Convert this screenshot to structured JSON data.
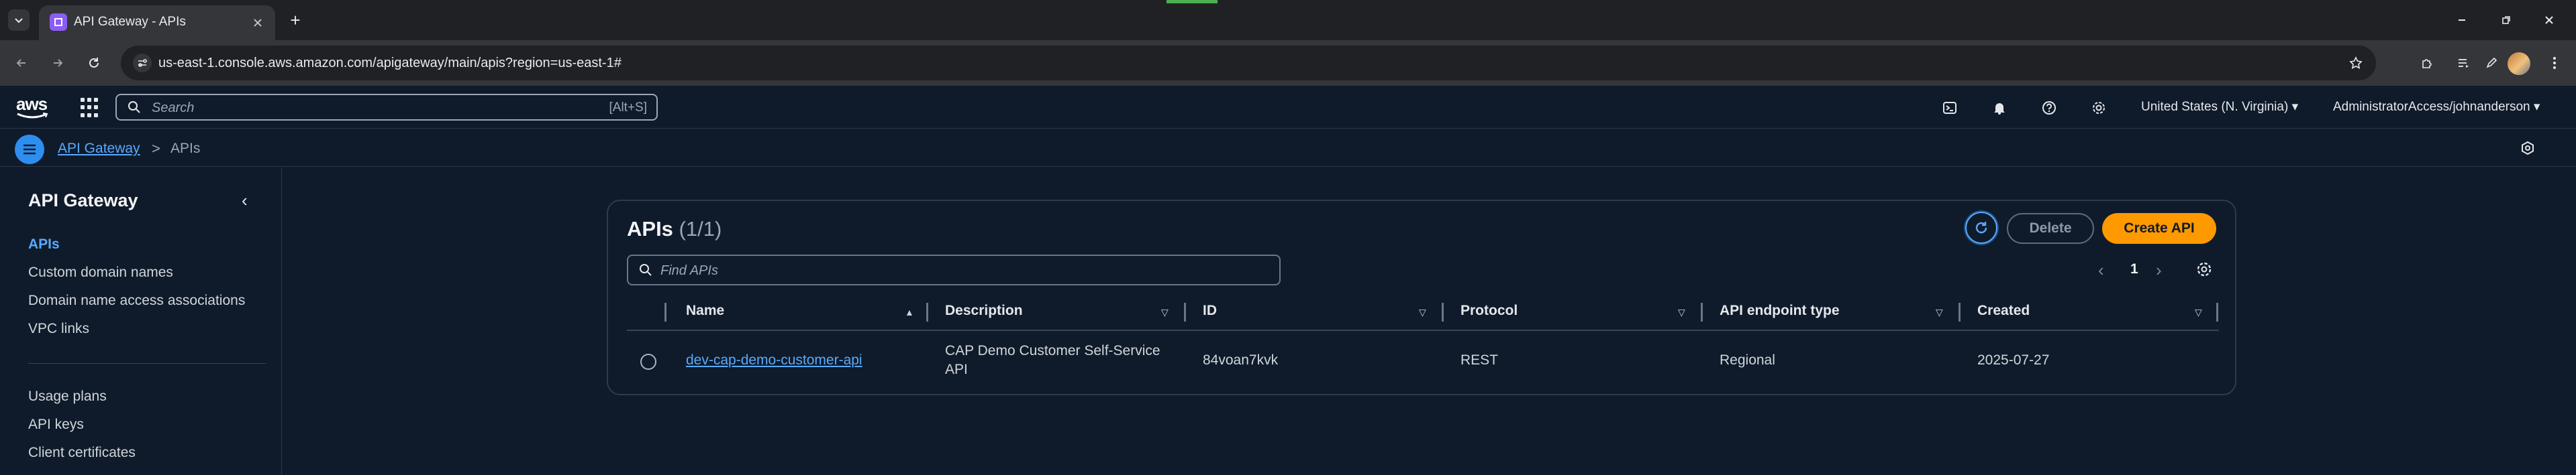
{
  "browser": {
    "tab_title": "API Gateway - APIs",
    "url": "us-east-1.console.aws.amazon.com/apigateway/main/apis?region=us-east-1#"
  },
  "console": {
    "logo_text": "aws",
    "search_placeholder": "Search",
    "search_shortcut": "[Alt+S]",
    "region": "United States (N. Virginia) ▾",
    "account": "AdministratorAccess/johnanderson ▾"
  },
  "breadcrumb": {
    "service": "API Gateway",
    "separator": ">",
    "current": "APIs"
  },
  "sidebar": {
    "title": "API Gateway",
    "items": [
      {
        "label": "APIs"
      },
      {
        "label": "Custom domain names"
      },
      {
        "label": "Domain name access associations"
      },
      {
        "label": "VPC links"
      },
      {
        "label": "Usage plans"
      },
      {
        "label": "API keys"
      },
      {
        "label": "Client certificates"
      }
    ]
  },
  "panel": {
    "title": "APIs",
    "count": "(1/1)",
    "delete_label": "Delete",
    "create_label": "Create API",
    "find_placeholder": "Find APIs",
    "page_number": "1",
    "columns": [
      "Name",
      "Description",
      "ID",
      "Protocol",
      "API endpoint type",
      "Created"
    ],
    "rows": [
      {
        "name": "dev-cap-demo-customer-api",
        "description_line1": "CAP Demo Customer Self-Service",
        "description_line2": "API",
        "id": "84voan7kvk",
        "protocol": "REST",
        "endpoint_type": "Regional",
        "created": "2025-07-27"
      }
    ]
  },
  "colors": {
    "accent": "#5aa9ff",
    "primary_button": "#ff9900",
    "background": "#0f1b2a"
  }
}
